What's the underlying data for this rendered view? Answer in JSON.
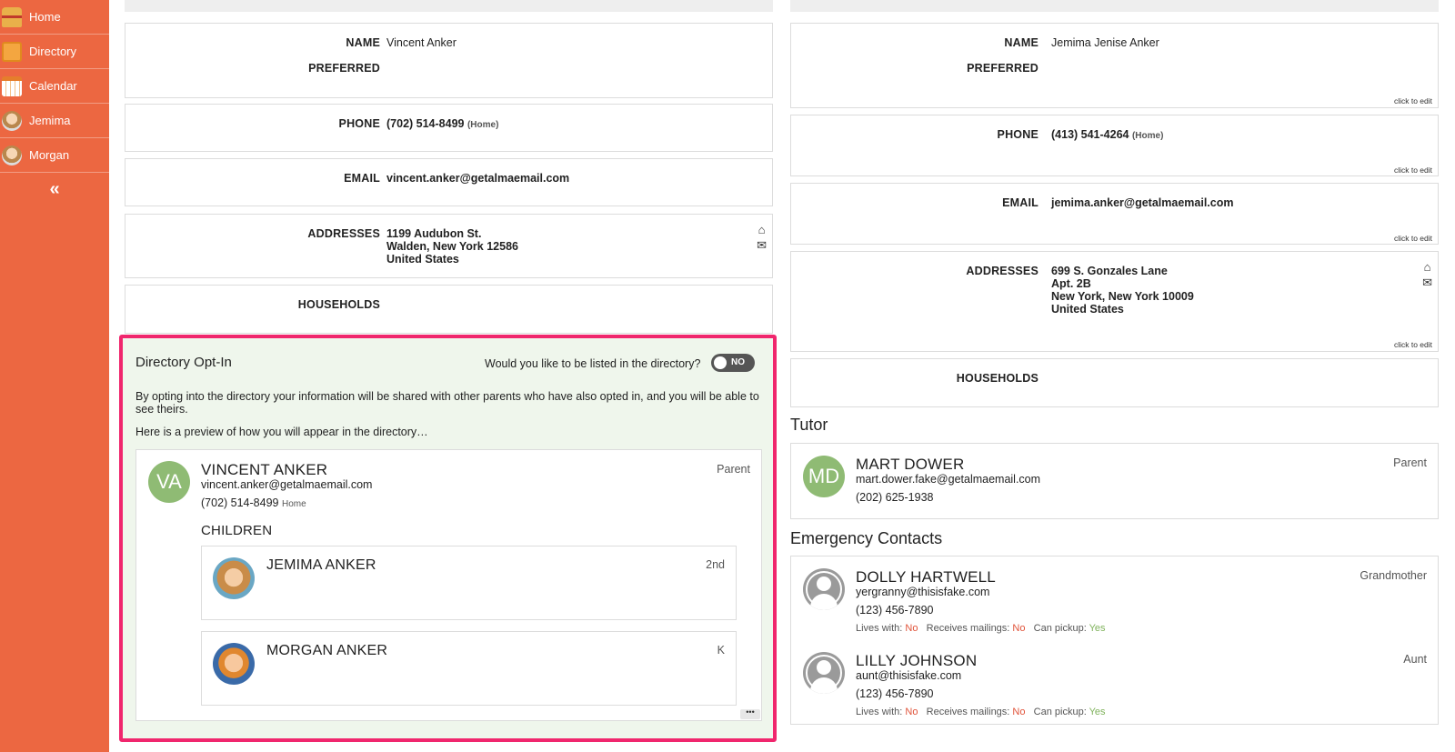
{
  "sidebar": {
    "items": [
      {
        "label": "Home",
        "icon": "school-house-icon"
      },
      {
        "label": "Directory",
        "icon": "directory-book-icon"
      },
      {
        "label": "Calendar",
        "icon": "calendar-icon"
      },
      {
        "label": "Jemima",
        "icon": "student-avatar"
      },
      {
        "label": "Morgan",
        "icon": "student-avatar"
      }
    ],
    "collapse_glyph": "«",
    "bg_color": "#ec6741"
  },
  "left": {
    "name_label": "NAME",
    "name_value": "Vincent Anker",
    "preferred_label": "PREFERRED",
    "phone_label": "PHONE",
    "phone_value": "(702) 514-8499",
    "phone_type": "(Home)",
    "email_label": "EMAIL",
    "email_value": "vincent.anker@getalmaemail.com",
    "addresses_label": "ADDRESSES",
    "address_lines": [
      "1199 Audubon St.",
      "Walden, New York 12586",
      "United States"
    ],
    "households_label": "HOUSEHOLDS"
  },
  "optin": {
    "title": "Directory Opt-In",
    "question": "Would you like to be listed in the directory?",
    "toggle_text": "NO",
    "description": "By opting into the directory your information will be shared with other parents who have also opted in, and you will be able to see theirs.",
    "preview_text": "Here is a preview of how you will appear in the directory…",
    "highlight_color": "#f0266d",
    "preview": {
      "initials": "VA",
      "name": "VINCENT ANKER",
      "email": "vincent.anker@getalmaemail.com",
      "phone": "(702) 514-8499",
      "phone_type": "Home",
      "role": "Parent",
      "children_heading": "CHILDREN",
      "children": [
        {
          "name": "JEMIMA ANKER",
          "grade": "2nd"
        },
        {
          "name": "MORGAN ANKER",
          "grade": "K"
        }
      ],
      "more_glyph": "•••"
    }
  },
  "right": {
    "name_label": "NAME",
    "name_value": "Jemima Jenise Anker",
    "preferred_label": "PREFERRED",
    "click_to_edit": "click to edit",
    "phone_label": "PHONE",
    "phone_value": "(413) 541-4264",
    "phone_type": "(Home)",
    "email_label": "EMAIL",
    "email_value": "jemima.anker@getalmaemail.com",
    "addresses_label": "ADDRESSES",
    "address_lines": [
      "699 S. Gonzales Lane",
      "Apt. 2B",
      "New York, New York 10009",
      "United States"
    ],
    "households_label": "HOUSEHOLDS",
    "tutor_heading": "Tutor",
    "tutor": {
      "initials": "MD",
      "name": "MART DOWER",
      "email": "mart.dower.fake@getalmaemail.com",
      "phone": "(202) 625-1938",
      "role": "Parent"
    },
    "emergency_heading": "Emergency Contacts",
    "emergency": [
      {
        "name": "DOLLY HARTWELL",
        "email": "yergranny@thisisfake.com",
        "phone": "(123) 456-7890",
        "role": "Grandmother",
        "lives_with_label": "Lives with:",
        "lives_with": "No",
        "mailings_label": "Receives mailings:",
        "mailings": "No",
        "pickup_label": "Can pickup:",
        "pickup": "Yes"
      },
      {
        "name": "LILLY JOHNSON",
        "email": "aunt@thisisfake.com",
        "phone": "(123) 456-7890",
        "role": "Aunt",
        "lives_with_label": "Lives with:",
        "lives_with": "No",
        "mailings_label": "Receives mailings:",
        "mailings": "No",
        "pickup_label": "Can pickup:",
        "pickup": "Yes"
      }
    ]
  }
}
